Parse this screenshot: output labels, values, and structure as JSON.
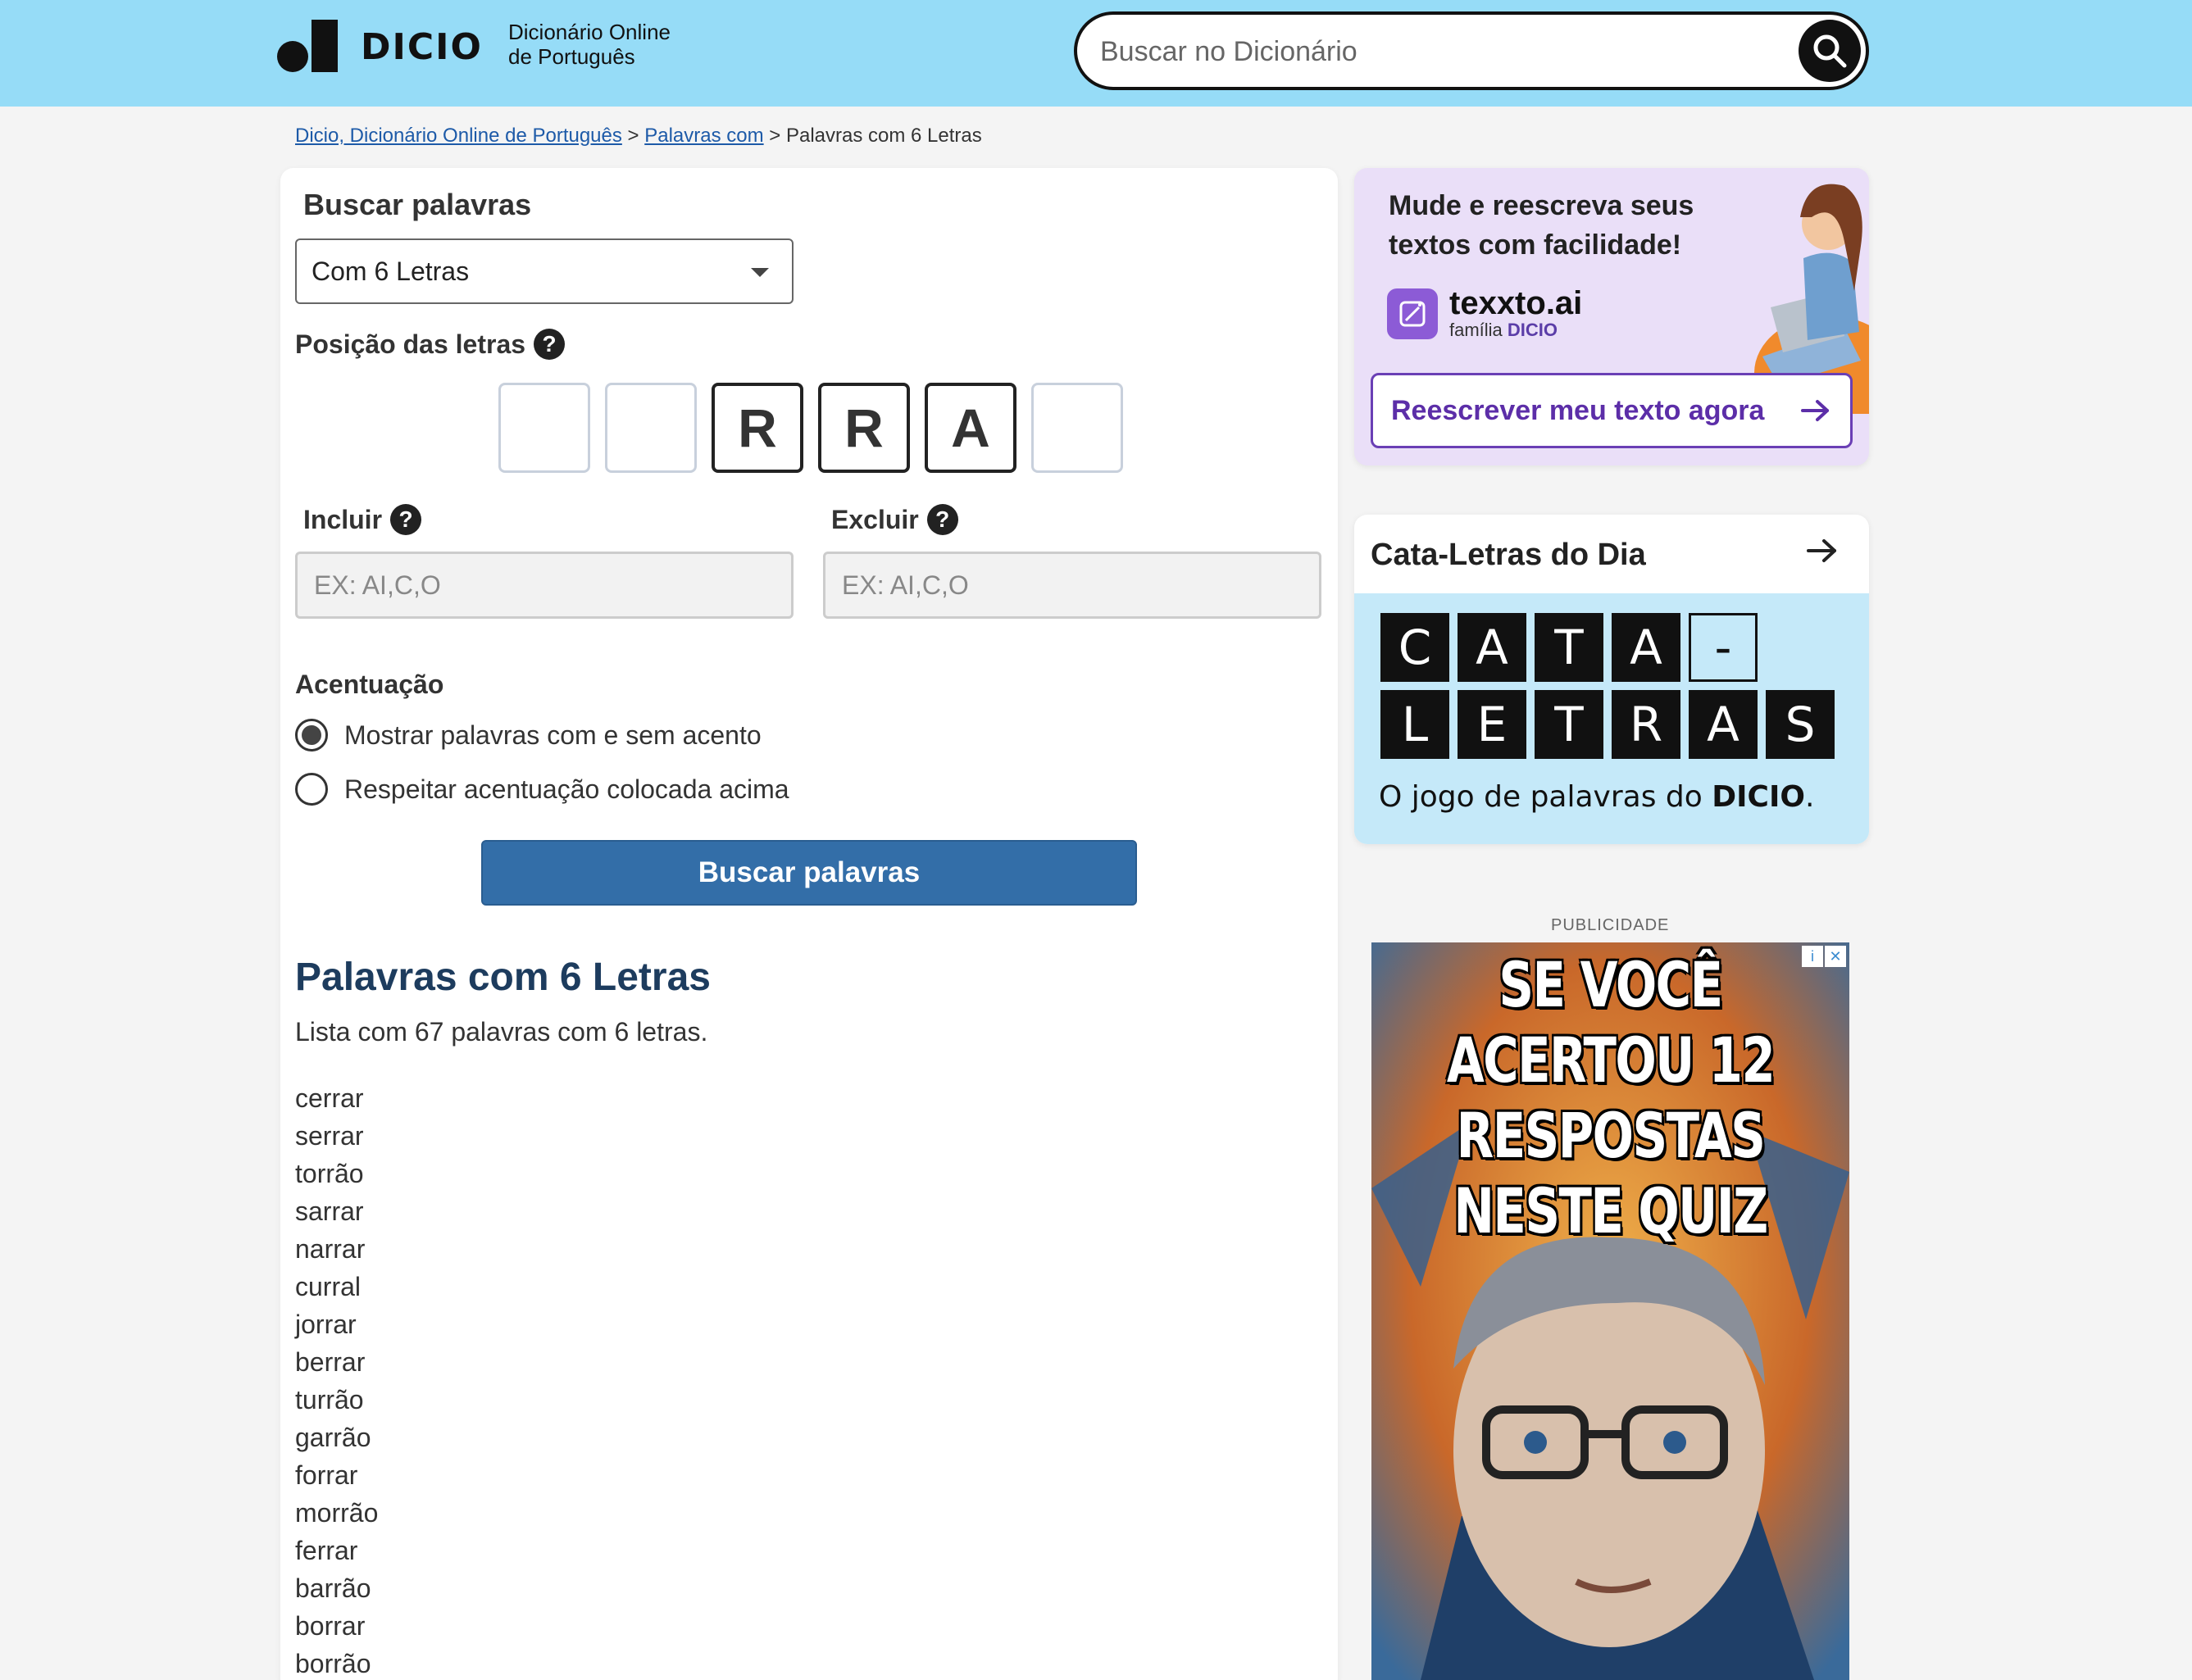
{
  "header": {
    "logo_text": "DICIO",
    "logo_sub_line1": "Dicionário Online",
    "logo_sub_line2": "de Português",
    "search_placeholder": "Buscar no Dicionário"
  },
  "breadcrumb": {
    "home": "Dicio, Dicionário Online de Português",
    "sep1": ">",
    "category": "Palavras com",
    "sep2": ">",
    "current": "Palavras com 6 Letras"
  },
  "search_form": {
    "heading": "Buscar palavras",
    "select_value": "Com 6 Letras",
    "positions_label": "Posição das letras",
    "positions": [
      "",
      "",
      "R",
      "R",
      "A",
      ""
    ],
    "include_label": "Incluir",
    "include_placeholder": "EX: AI,C,O",
    "exclude_label": "Excluir",
    "exclude_placeholder": "EX: AI,C,O",
    "accent_label": "Acentuação",
    "accent_options": [
      "Mostrar palavras com e sem acento",
      "Respeitar acentuação colocada acima"
    ],
    "accent_selected": 0,
    "submit_label": "Buscar palavras",
    "help_glyph": "?"
  },
  "results": {
    "title": "Palavras com 6 Letras",
    "summary": "Lista com 67 palavras com 6 letras.",
    "words": [
      "cerrar",
      "serrar",
      "torrão",
      "sarrar",
      "narrar",
      "curral",
      "jorrar",
      "berrar",
      "turrão",
      "garrão",
      "forrar",
      "morrão",
      "ferrar",
      "barrão",
      "borrar",
      "borrão"
    ]
  },
  "promo": {
    "title": "Mude e reescreva seus textos com facilidade!",
    "brand": "texxto.ai",
    "family_prefix": "família",
    "family_brand": "DICIO",
    "button_label": "Reescrever meu texto agora"
  },
  "cata_letras": {
    "heading": "Cata-Letras do Dia",
    "row1": [
      "C",
      "A",
      "T",
      "A",
      "-"
    ],
    "row2": [
      "L",
      "E",
      "T",
      "R",
      "A",
      "S"
    ],
    "tagline_prefix": "O jogo de palavras do",
    "tagline_brand": "DICIO",
    "tagline_suffix": "."
  },
  "ad": {
    "label": "PUBLICIDADE",
    "headline": [
      "SE VOCÊ",
      "ACERTOU 12",
      "RESPOSTAS",
      "NESTE QUIZ"
    ],
    "badge_info": "i",
    "badge_close": "✕"
  },
  "colors": {
    "header_bg": "#96dcf7",
    "primary_button": "#336ea8",
    "result_title": "#1d3c5e",
    "promo_bg": "#eadff8",
    "promo_accent": "#5c2ea8",
    "cata_bg": "#c5e9f9"
  }
}
